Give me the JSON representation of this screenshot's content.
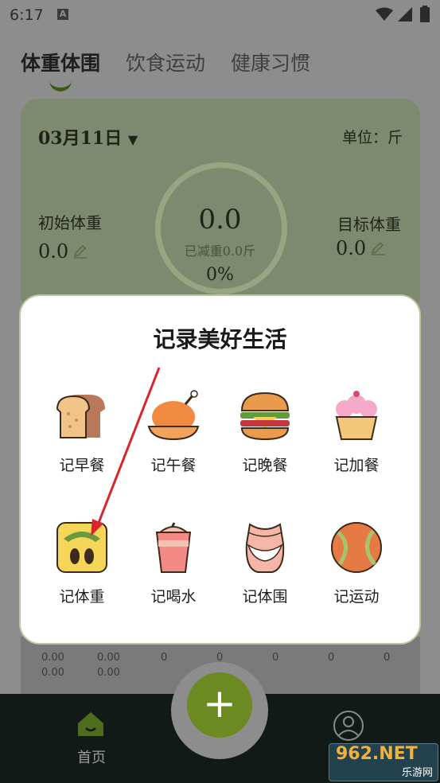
{
  "status_bar": {
    "time": "6:17",
    "notif_glyph": "A"
  },
  "tabs": [
    {
      "label": "体重体围",
      "active": true
    },
    {
      "label": "饮食运动",
      "active": false
    },
    {
      "label": "健康习惯",
      "active": false
    }
  ],
  "weight_card": {
    "date": "03月11日",
    "unit": "单位：斤",
    "initial_label": "初始体重",
    "initial_value": "0.0",
    "target_label": "目标体重",
    "target_value": "0.0",
    "center_value": "0.0",
    "center_sub": "已减重0.0斤",
    "center_percent": "0%"
  },
  "modal": {
    "title": "记录美好生活",
    "items": [
      {
        "label": "记早餐",
        "icon": "bread-icon"
      },
      {
        "label": "记午餐",
        "icon": "roast-chicken-icon"
      },
      {
        "label": "记晚餐",
        "icon": "burger-icon"
      },
      {
        "label": "记加餐",
        "icon": "cupcake-icon"
      },
      {
        "label": "记体重",
        "icon": "scale-icon"
      },
      {
        "label": "记喝水",
        "icon": "drink-cup-icon"
      },
      {
        "label": "记体围",
        "icon": "waist-icon"
      },
      {
        "label": "记运动",
        "icon": "baseball-icon"
      }
    ]
  },
  "table_numbers": {
    "row1": [
      "0.00",
      "0.00",
      "0",
      "0",
      "0",
      "0",
      "0"
    ],
    "row2": [
      "0.00",
      "0.00"
    ]
  },
  "bottom_nav": {
    "home_label": "首页",
    "add_glyph": "+"
  },
  "watermark": {
    "brand": "962.NET",
    "sub": "乐游网"
  },
  "colors": {
    "accent": "#8db23c",
    "nav_bg": "#111a17",
    "card_bg": "#c8d6b0",
    "arrow": "#d9262c"
  }
}
